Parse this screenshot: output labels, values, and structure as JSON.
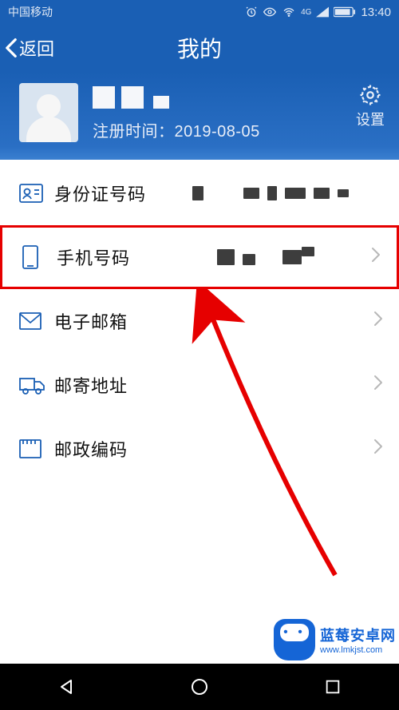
{
  "status": {
    "carrier": "中国移动",
    "time": "13:40",
    "net_label": "4G"
  },
  "header": {
    "back_label": "返回",
    "title": "我的"
  },
  "profile": {
    "reg_prefix": "注册时间：",
    "reg_date": "2019-08-05",
    "settings_label": "设置"
  },
  "rows": {
    "id_card": {
      "label": "身份证号码"
    },
    "phone": {
      "label": "手机号码"
    },
    "email": {
      "label": "电子邮箱"
    },
    "address": {
      "label": "邮寄地址"
    },
    "postcode": {
      "label": "邮政编码"
    }
  },
  "watermark": {
    "line1": "蓝莓安卓网",
    "line2": "www.lmkjst.com"
  }
}
